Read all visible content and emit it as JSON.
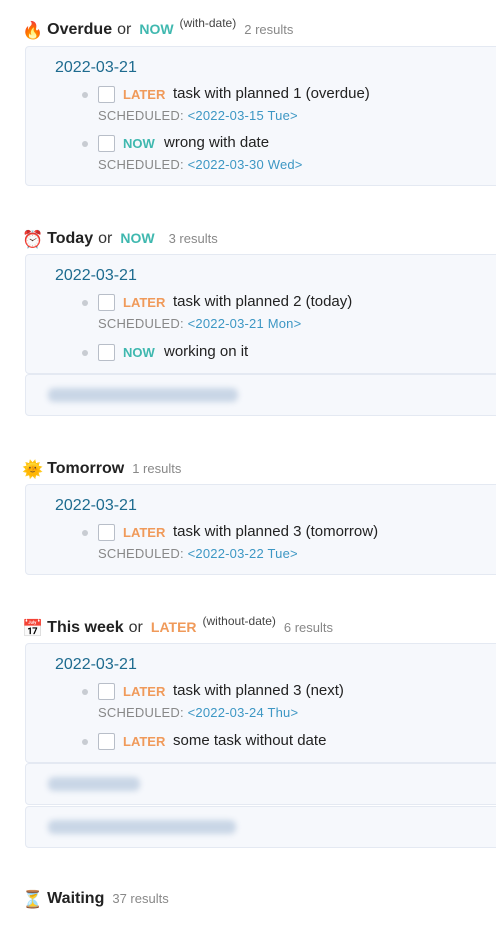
{
  "sections": [
    {
      "emoji": "🔥",
      "title": "Overdue",
      "or": "or",
      "keyword": "NOW",
      "note": "(with-date)",
      "count": "2 results",
      "date": "2022-03-21",
      "tasks": [
        {
          "marker": "LATER",
          "text": "task with planned 1 (overdue)",
          "scheduled_label": "SCHEDULED:",
          "scheduled_date": "<2022-03-15 Tue>"
        },
        {
          "marker": "NOW",
          "text": "wrong with date",
          "scheduled_label": "SCHEDULED:",
          "scheduled_date": "<2022-03-30 Wed>"
        }
      ]
    },
    {
      "emoji": "⏰",
      "title": "Today",
      "or": "or",
      "keyword": "NOW",
      "count": "3 results",
      "date": "2022-03-21",
      "tasks": [
        {
          "marker": "LATER",
          "text": "task with planned 2 (today)",
          "scheduled_label": "SCHEDULED:",
          "scheduled_date": "<2022-03-21 Mon>"
        },
        {
          "marker": "NOW",
          "text": "working on it"
        }
      ]
    },
    {
      "emoji": "🌞",
      "title": "Tomorrow",
      "count": "1 results",
      "date": "2022-03-21",
      "tasks": [
        {
          "marker": "LATER",
          "text": "task with planned 3 (tomorrow)",
          "scheduled_label": "SCHEDULED:",
          "scheduled_date": "<2022-03-22 Tue>"
        }
      ]
    },
    {
      "emoji": "📅",
      "title": "This week",
      "or": "or",
      "keyword": "LATER",
      "note": "(without-date)",
      "count": "6 results",
      "date": "2022-03-21",
      "tasks": [
        {
          "marker": "LATER",
          "text": "task with planned 3 (next)",
          "scheduled_label": "SCHEDULED:",
          "scheduled_date": "<2022-03-24 Thu>"
        },
        {
          "marker": "LATER",
          "text": "some task without date"
        }
      ]
    },
    {
      "emoji": "⏳",
      "title": "Waiting",
      "count": "37 results"
    }
  ],
  "colors": {
    "now": "#3fb8af",
    "later": "#f09a5a",
    "date_link": "#1e6b8f",
    "scheduled_date": "#3d97c4"
  }
}
